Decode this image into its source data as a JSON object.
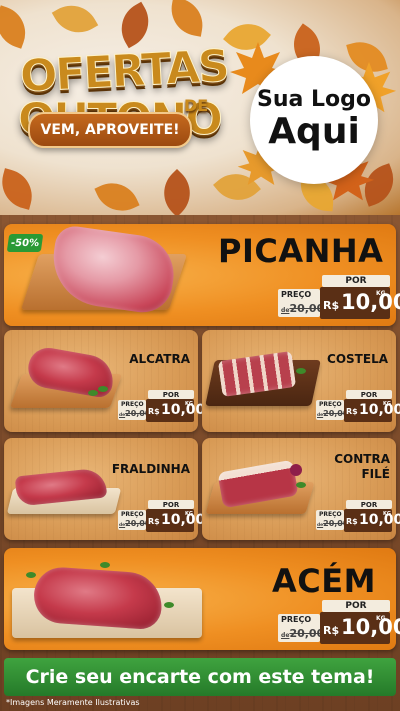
{
  "header": {
    "title_line1": "OFERTAS",
    "title_line2": "OUTONO",
    "title_de": "DE",
    "ribbon": "VEM, APROVEITE!",
    "logo_line1": "Sua Logo",
    "logo_line2": "Aqui"
  },
  "colors": {
    "accent_orange": "#ef8f22",
    "price_brown": "#5a2f15",
    "cta_green": "#2f8f32",
    "discount_green": "#2a9a35"
  },
  "price_labels": {
    "por": "POR",
    "preco": "PREÇO",
    "de": "de",
    "currency": "R$",
    "unit": "KG"
  },
  "products": [
    {
      "name": "PICANHA",
      "discount": "-50%",
      "old_price": "20,00",
      "new_price": "10,00"
    },
    {
      "name": "ALCATRA",
      "old_price": "20,00",
      "new_price": "10,00"
    },
    {
      "name": "COSTELA",
      "old_price": "20,00",
      "new_price": "10,00"
    },
    {
      "name": "FRALDINHA",
      "old_price": "20,00",
      "new_price": "10,00"
    },
    {
      "name_line1": "CONTRA",
      "name_line2": "FILÉ",
      "old_price": "20,00",
      "new_price": "10,00"
    },
    {
      "name": "ACÉM",
      "old_price": "20,00",
      "new_price": "10,00"
    }
  ],
  "footer": {
    "cta": "Crie seu encarte com este tema!",
    "disclaimer": "*Imagens Meramente Ilustrativas"
  }
}
